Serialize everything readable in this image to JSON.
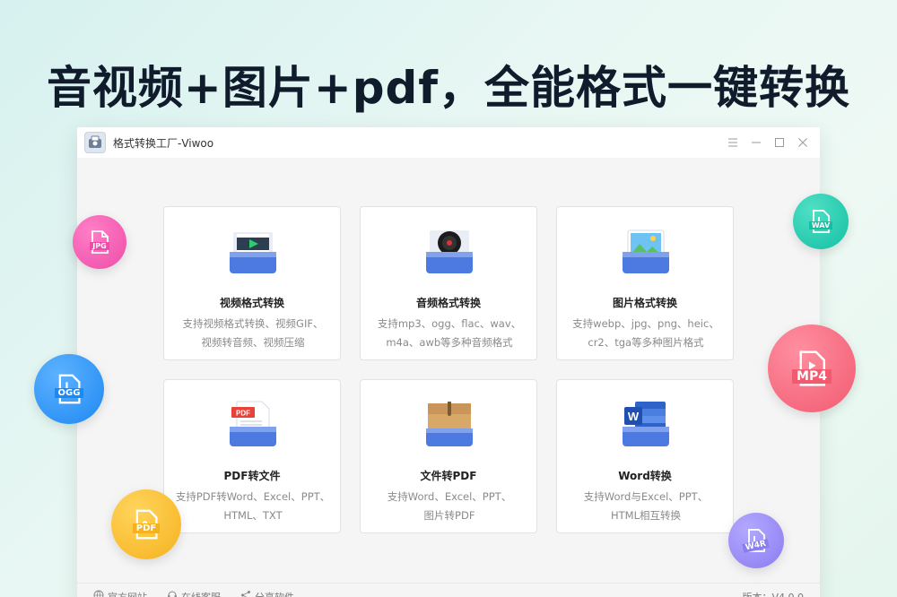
{
  "headline": "音视频+图片+pdf，全能格式一键转换",
  "window": {
    "title": "格式转换工厂-Viwoo",
    "controls": [
      "menu-icon",
      "minimize-icon",
      "maximize-icon",
      "close-icon"
    ]
  },
  "cards": [
    {
      "title": "视频格式转换",
      "desc1": "支持视频格式转换、视频GIF、",
      "desc2": "视频转音频、视频压缩",
      "icon": "video-icon"
    },
    {
      "title": "音频格式转换",
      "desc1": "支持mp3、ogg、flac、wav、",
      "desc2": "m4a、awb等多种音频格式",
      "icon": "audio-icon"
    },
    {
      "title": "图片格式转换",
      "desc1": "支持webp、jpg、png、heic、",
      "desc2": "cr2、tga等多种图片格式",
      "icon": "image-icon"
    },
    {
      "title": "PDF转文件",
      "desc1": "支持PDF转Word、Excel、PPT、",
      "desc2": "HTML、TXT",
      "icon": "pdf-icon",
      "badge": "PDF"
    },
    {
      "title": "文件转PDF",
      "desc1": "支持Word、Excel、PPT、",
      "desc2": "图片转PDF",
      "icon": "folder-icon"
    },
    {
      "title": "Word转换",
      "desc1": "支持Word与Excel、PPT、",
      "desc2": "HTML相互转换",
      "icon": "word-icon",
      "badge": "W"
    }
  ],
  "footer": {
    "links": [
      "官方网站",
      "在线客服",
      "分享软件"
    ],
    "version": "版本：V4.0.0"
  },
  "bubbles": {
    "jpg": "JPG",
    "wav": "WAV",
    "ogg": "OGG",
    "mp4": "MP4",
    "pdf": "PDF",
    "w4r": "W4R"
  },
  "colors": {
    "jpg": "#ee4ca8",
    "wav": "#14bfa4",
    "ogg": "#1e88f2",
    "mp4": "#f25a70",
    "pdf": "#f6b21e",
    "w4r": "#8b7cf0"
  }
}
